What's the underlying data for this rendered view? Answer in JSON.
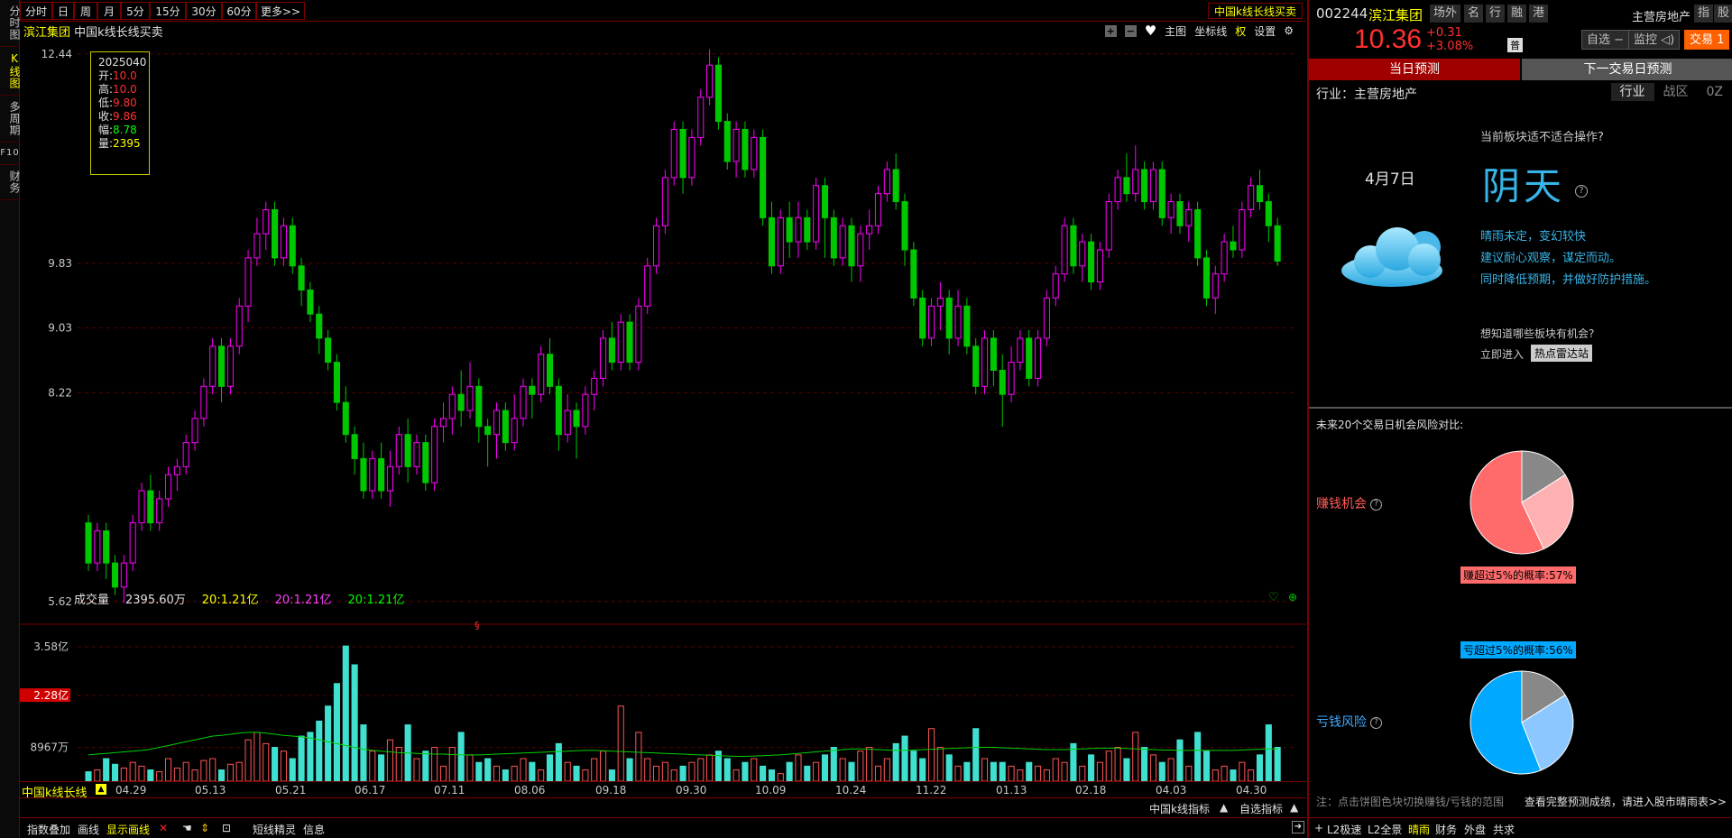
{
  "vtabs": [
    "分时图",
    "K线图",
    "多周期",
    "F10",
    "财务"
  ],
  "periods": [
    "分时",
    "日",
    "周",
    "月",
    "5分",
    "15分",
    "30分",
    "60分",
    "更多>>"
  ],
  "indicator_tag": "中国k线长线买卖",
  "chart": {
    "stock_name": "滨江集团",
    "indicator_title": "中国k线长线买卖",
    "tools": {
      "main": "主图",
      "coord": "坐标线",
      "right": "权",
      "settings": "设置"
    },
    "info": {
      "date": "2025040",
      "open_label": "开:",
      "open": "10.0",
      "high_label": "高:",
      "high": "10.0",
      "low_label": "低:",
      "low": "9.80",
      "close_label": "收:",
      "close": "9.86",
      "amp_label": "幅:",
      "amp": "8.78",
      "vol_label": "量:",
      "vol": "2395"
    },
    "marker": "§"
  },
  "volume": {
    "label": "成交量",
    "value": "2395.60万",
    "ma1": "20:1.21亿",
    "ma2": "20:1.21亿",
    "ma3": "20:1.21亿",
    "highlight": "2.28亿"
  },
  "dates": [
    "04.29",
    "05.13",
    "05.21",
    "06.17",
    "07.11",
    "08.06",
    "09.18",
    "09.30",
    "10.09",
    "10.24",
    "11.22",
    "01.13",
    "02.18",
    "04.03",
    "04.30"
  ],
  "indicator_name": "中国k线长线",
  "indicator_switch": {
    "a": "中国k线指标",
    "b": "自选指标"
  },
  "bottom_toolbar": {
    "overlay": "指数叠加",
    "draw": "画线",
    "show_draw": "显示画线",
    "shortline": "短线精灵",
    "info": "信息"
  },
  "quote": {
    "code": "002244",
    "name": "滨江集团",
    "price": "10.36",
    "change": "+0.31",
    "pct": "+3.08%",
    "sector": "主营房地产",
    "btns": [
      "场外",
      "名",
      "行",
      "融",
      "港"
    ],
    "corner": [
      "指",
      "股"
    ],
    "watch": "自选 −",
    "monitor": "监控",
    "trade": "交易 1",
    "badge": "普"
  },
  "forecast_tabs": [
    "当日预测",
    "下一交易日预测"
  ],
  "industry": {
    "label": "行业：主营房地产",
    "tabs": [
      "行业",
      "战区",
      "0Z"
    ]
  },
  "outlook": {
    "question": "当前板块适不适合操作?",
    "date": "4月7日",
    "weather": "阴天",
    "lines": [
      "晴雨未定，变幻较快",
      "建议耐心观察，谋定而动。",
      "同时降低预期，并做好防护措施。"
    ],
    "ask": "想知道哪些板块有机会?",
    "enter": "立即进入",
    "radar": "热点雷达站"
  },
  "risk": {
    "title": "未来20个交易日机会风险对比:",
    "gain_label": "赚钱机会",
    "gain_prob": "赚超过5%的概率:57%",
    "gain_pct": 57,
    "loss_label": "亏钱风险",
    "loss_prob": "亏超过5%的概率:56%",
    "loss_pct": 56,
    "note": "注：点击饼图色块切换赚钱/亏钱的范围",
    "more": "查看完整预测成绩，请进入股市晴雨表>>"
  },
  "right_bottom": [
    "L2极速",
    "L2全景",
    "晴雨",
    "财务",
    "外盘",
    "共求"
  ],
  "colors": {
    "up": "#ff00ff",
    "down": "#00c800",
    "vol_up": "#ff5555",
    "vol_down": "#40e0d0",
    "accent": "#ffff00",
    "frame": "#7a0000",
    "gain": "#ff6a6a",
    "loss": "#00a8ff"
  },
  "chart_data": {
    "type": "candlestick",
    "y_ticks": [
      "12.44",
      "9.83",
      "9.03",
      "8.22",
      "5.62"
    ],
    "vol_ticks": [
      "3.58亿",
      "2.28亿",
      "8967万"
    ],
    "ylim": [
      5.45,
      12.55
    ],
    "candles": [
      [
        6.6,
        6.1,
        6.7,
        6.0
      ],
      [
        6.1,
        6.5,
        6.6,
        6.0
      ],
      [
        6.5,
        6.1,
        6.6,
        5.9
      ],
      [
        6.1,
        5.8,
        6.2,
        5.7
      ],
      [
        5.8,
        6.1,
        6.2,
        5.6
      ],
      [
        6.1,
        6.6,
        6.7,
        6.0
      ],
      [
        6.6,
        7.0,
        7.1,
        6.5
      ],
      [
        7.0,
        6.6,
        7.2,
        6.5
      ],
      [
        6.6,
        6.9,
        7.0,
        6.5
      ],
      [
        6.9,
        7.2,
        7.3,
        6.8
      ],
      [
        7.2,
        7.3,
        7.4,
        7.0
      ],
      [
        7.3,
        7.6,
        7.7,
        7.2
      ],
      [
        7.6,
        7.9,
        8.0,
        7.5
      ],
      [
        7.9,
        8.3,
        8.4,
        7.8
      ],
      [
        8.3,
        8.8,
        8.9,
        8.2
      ],
      [
        8.8,
        8.3,
        8.9,
        8.1
      ],
      [
        8.3,
        8.8,
        8.9,
        8.2
      ],
      [
        8.8,
        9.3,
        9.4,
        8.7
      ],
      [
        9.3,
        9.9,
        10.0,
        9.1
      ],
      [
        9.9,
        10.2,
        10.4,
        9.8
      ],
      [
        10.2,
        10.5,
        10.6,
        10.0
      ],
      [
        10.5,
        9.9,
        10.6,
        9.8
      ],
      [
        9.9,
        10.3,
        10.4,
        9.8
      ],
      [
        10.3,
        9.8,
        10.4,
        9.7
      ],
      [
        9.8,
        9.5,
        9.9,
        9.3
      ],
      [
        9.5,
        9.2,
        9.6,
        9.1
      ],
      [
        9.2,
        8.9,
        9.3,
        8.7
      ],
      [
        8.9,
        8.6,
        9.0,
        8.5
      ],
      [
        8.6,
        8.1,
        8.7,
        8.0
      ],
      [
        8.1,
        7.7,
        8.3,
        7.6
      ],
      [
        7.7,
        7.4,
        7.8,
        7.2
      ],
      [
        7.4,
        7.0,
        7.6,
        6.9
      ],
      [
        7.0,
        7.4,
        7.5,
        6.9
      ],
      [
        7.4,
        7.0,
        7.6,
        6.9
      ],
      [
        7.0,
        7.3,
        7.5,
        6.8
      ],
      [
        7.3,
        7.7,
        7.8,
        7.2
      ],
      [
        7.7,
        7.3,
        7.9,
        7.1
      ],
      [
        7.3,
        7.6,
        7.7,
        7.2
      ],
      [
        7.6,
        7.1,
        7.7,
        7.0
      ],
      [
        7.1,
        7.8,
        7.9,
        7.0
      ],
      [
        7.8,
        7.9,
        8.1,
        7.6
      ],
      [
        7.9,
        8.2,
        8.3,
        7.7
      ],
      [
        8.2,
        8.0,
        8.5,
        7.8
      ],
      [
        8.0,
        8.3,
        8.6,
        7.9
      ],
      [
        8.3,
        7.8,
        8.4,
        7.6
      ],
      [
        7.8,
        7.7,
        7.9,
        7.3
      ],
      [
        7.7,
        8.0,
        8.1,
        7.4
      ],
      [
        8.0,
        7.6,
        8.1,
        7.5
      ],
      [
        7.6,
        7.9,
        8.2,
        7.5
      ],
      [
        7.9,
        8.3,
        8.4,
        7.8
      ],
      [
        8.3,
        8.2,
        8.4,
        7.9
      ],
      [
        8.2,
        8.7,
        8.8,
        8.1
      ],
      [
        8.7,
        8.3,
        8.9,
        8.2
      ],
      [
        8.3,
        7.7,
        8.4,
        7.5
      ],
      [
        7.7,
        8.0,
        8.2,
        7.6
      ],
      [
        8.0,
        7.8,
        8.1,
        7.4
      ],
      [
        7.8,
        8.2,
        8.3,
        7.7
      ],
      [
        8.2,
        8.4,
        8.5,
        8.0
      ],
      [
        8.4,
        8.9,
        9.0,
        8.3
      ],
      [
        8.9,
        8.6,
        9.1,
        8.5
      ],
      [
        8.6,
        9.1,
        9.2,
        8.5
      ],
      [
        9.1,
        8.6,
        9.2,
        8.5
      ],
      [
        8.6,
        9.3,
        9.4,
        8.5
      ],
      [
        9.3,
        9.8,
        9.9,
        9.2
      ],
      [
        9.8,
        10.3,
        10.4,
        9.7
      ],
      [
        10.3,
        10.9,
        11.0,
        10.2
      ],
      [
        10.9,
        11.5,
        11.6,
        10.8
      ],
      [
        11.5,
        10.9,
        11.6,
        10.7
      ],
      [
        10.9,
        11.4,
        11.5,
        10.8
      ],
      [
        11.4,
        11.9,
        12.0,
        11.3
      ],
      [
        11.9,
        12.3,
        12.5,
        11.8
      ],
      [
        12.3,
        11.6,
        12.4,
        11.5
      ],
      [
        11.6,
        11.1,
        11.7,
        11.0
      ],
      [
        11.1,
        11.5,
        11.6,
        10.9
      ],
      [
        11.5,
        11.0,
        11.6,
        10.9
      ],
      [
        11.0,
        11.4,
        11.5,
        10.9
      ],
      [
        11.4,
        10.4,
        11.5,
        10.3
      ],
      [
        10.4,
        9.8,
        10.6,
        9.7
      ],
      [
        9.8,
        10.4,
        10.5,
        9.7
      ],
      [
        10.4,
        10.1,
        10.6,
        9.9
      ],
      [
        10.1,
        10.4,
        10.6,
        9.9
      ],
      [
        10.4,
        10.1,
        10.5,
        10.0
      ],
      [
        10.1,
        10.8,
        10.9,
        10.0
      ],
      [
        10.8,
        10.4,
        10.9,
        9.9
      ],
      [
        10.4,
        9.9,
        10.5,
        9.8
      ],
      [
        9.9,
        10.3,
        10.4,
        9.8
      ],
      [
        10.3,
        9.8,
        10.4,
        9.6
      ],
      [
        9.8,
        10.2,
        10.3,
        9.6
      ],
      [
        10.2,
        10.3,
        10.5,
        10.0
      ],
      [
        10.3,
        10.7,
        10.8,
        10.2
      ],
      [
        10.7,
        11.0,
        11.1,
        10.6
      ],
      [
        11.0,
        10.6,
        11.2,
        10.5
      ],
      [
        10.6,
        10.0,
        10.7,
        9.8
      ],
      [
        10.0,
        9.4,
        10.1,
        9.3
      ],
      [
        9.4,
        8.9,
        9.5,
        8.8
      ],
      [
        8.9,
        9.3,
        9.4,
        8.8
      ],
      [
        9.3,
        9.4,
        9.6,
        9.0
      ],
      [
        9.4,
        8.9,
        9.5,
        8.7
      ],
      [
        8.9,
        9.3,
        9.5,
        8.8
      ],
      [
        9.3,
        8.8,
        9.4,
        8.7
      ],
      [
        8.8,
        8.3,
        8.9,
        8.2
      ],
      [
        8.3,
        8.9,
        9.0,
        8.2
      ],
      [
        8.9,
        8.5,
        9.0,
        8.3
      ],
      [
        8.5,
        8.2,
        8.7,
        7.8
      ],
      [
        8.2,
        8.6,
        8.8,
        8.1
      ],
      [
        8.6,
        8.9,
        9.0,
        8.5
      ],
      [
        8.9,
        8.4,
        9.0,
        8.3
      ],
      [
        8.4,
        8.9,
        9.0,
        8.3
      ],
      [
        8.9,
        9.4,
        9.5,
        8.8
      ],
      [
        9.4,
        9.7,
        9.8,
        9.3
      ],
      [
        9.7,
        10.3,
        10.4,
        9.6
      ],
      [
        10.3,
        9.8,
        10.4,
        9.7
      ],
      [
        9.8,
        10.1,
        10.2,
        9.6
      ],
      [
        10.1,
        9.6,
        10.2,
        9.5
      ],
      [
        9.6,
        10.0,
        10.1,
        9.5
      ],
      [
        10.0,
        10.6,
        10.7,
        9.9
      ],
      [
        10.6,
        10.9,
        11.0,
        10.5
      ],
      [
        10.9,
        10.7,
        11.2,
        10.6
      ],
      [
        10.7,
        11.0,
        11.3,
        10.6
      ],
      [
        11.0,
        10.6,
        11.1,
        10.5
      ],
      [
        10.6,
        11.0,
        11.1,
        10.5
      ],
      [
        11.0,
        10.4,
        11.1,
        10.3
      ],
      [
        10.4,
        10.6,
        10.7,
        10.2
      ],
      [
        10.6,
        10.3,
        10.7,
        10.2
      ],
      [
        10.3,
        10.5,
        10.6,
        10.1
      ],
      [
        10.5,
        9.9,
        10.6,
        9.8
      ],
      [
        9.9,
        9.4,
        10.0,
        9.3
      ],
      [
        9.4,
        9.7,
        9.8,
        9.2
      ],
      [
        9.7,
        10.1,
        10.2,
        9.6
      ],
      [
        10.1,
        10.0,
        10.3,
        9.9
      ],
      [
        10.0,
        10.5,
        10.6,
        9.9
      ],
      [
        10.5,
        10.8,
        10.9,
        10.4
      ],
      [
        10.8,
        10.6,
        11.0,
        10.5
      ],
      [
        10.6,
        10.3,
        10.7,
        10.1
      ],
      [
        10.3,
        9.86,
        10.4,
        9.8
      ]
    ],
    "volumes": [
      0.25,
      0.3,
      0.6,
      0.45,
      0.35,
      0.5,
      0.4,
      0.3,
      0.25,
      0.6,
      0.35,
      0.5,
      0.3,
      0.55,
      0.6,
      0.3,
      0.45,
      0.5,
      1.1,
      1.3,
      1.0,
      0.9,
      0.8,
      0.6,
      1.2,
      1.3,
      1.6,
      2.0,
      2.6,
      3.6,
      3.1,
      1.5,
      0.8,
      0.7,
      1.1,
      0.9,
      1.5,
      0.6,
      0.8,
      0.9,
      0.4,
      0.9,
      1.3,
      0.7,
      0.5,
      0.6,
      0.4,
      0.3,
      0.4,
      0.6,
      0.5,
      0.3,
      0.7,
      1.0,
      0.5,
      0.4,
      0.3,
      0.6,
      0.8,
      0.3,
      2.0,
      0.6,
      1.3,
      0.6,
      0.4,
      0.5,
      0.3,
      0.4,
      0.5,
      0.6,
      0.7,
      0.8,
      0.6,
      0.3,
      0.5,
      0.6,
      0.4,
      0.3,
      0.2,
      0.5,
      0.7,
      0.4,
      0.5,
      0.7,
      0.9,
      0.6,
      0.5,
      0.8,
      0.9,
      0.4,
      0.6,
      1.0,
      1.2,
      0.8,
      0.6,
      1.4,
      0.9,
      0.7,
      0.4,
      0.5,
      1.4,
      0.6,
      0.5,
      0.5,
      0.4,
      0.3,
      0.5,
      0.4,
      0.3,
      0.6,
      0.5,
      1.0,
      0.4,
      0.7,
      0.5,
      0.8,
      0.9,
      0.6,
      1.3,
      0.9,
      0.7,
      0.5,
      0.6,
      1.1,
      0.4,
      1.3,
      0.8,
      0.3,
      0.4,
      0.3,
      0.5,
      0.3,
      0.7,
      1.5,
      0.9
    ],
    "vol_ma": [
      0.7,
      0.72,
      0.74,
      0.76,
      0.78,
      0.8,
      0.82,
      0.85,
      0.9,
      0.95,
      1.0,
      1.05,
      1.1,
      1.15,
      1.2,
      1.22,
      1.25,
      1.28,
      1.3,
      1.3,
      1.28,
      1.25,
      1.22,
      1.2,
      1.18,
      1.15,
      1.1,
      1.05,
      1.0,
      0.95,
      0.9,
      0.85,
      0.82,
      0.8,
      0.78,
      0.76,
      0.75,
      0.74,
      0.73,
      0.72,
      0.72,
      0.71,
      0.7,
      0.7,
      0.7,
      0.71,
      0.72,
      0.73,
      0.74,
      0.75,
      0.76,
      0.77,
      0.78,
      0.79,
      0.8,
      0.81,
      0.82,
      0.82,
      0.81,
      0.8,
      0.79,
      0.78,
      0.77,
      0.76,
      0.75,
      0.74,
      0.73,
      0.72,
      0.71,
      0.7,
      0.69,
      0.68,
      0.67,
      0.66,
      0.66,
      0.67,
      0.68,
      0.69,
      0.7,
      0.72,
      0.74,
      0.76,
      0.78,
      0.8,
      0.82,
      0.84,
      0.86,
      0.86,
      0.85,
      0.84,
      0.83,
      0.82,
      0.82,
      0.83,
      0.84,
      0.85,
      0.86,
      0.87,
      0.88,
      0.89,
      0.9,
      0.9,
      0.9,
      0.89,
      0.88,
      0.87,
      0.86,
      0.85,
      0.84,
      0.84,
      0.84,
      0.85,
      0.86,
      0.87,
      0.88,
      0.88,
      0.88,
      0.87,
      0.86,
      0.85,
      0.84,
      0.83,
      0.83,
      0.82,
      0.82,
      0.82,
      0.82,
      0.82,
      0.82,
      0.82,
      0.83,
      0.84,
      0.85,
      0.86,
      0.86
    ]
  }
}
